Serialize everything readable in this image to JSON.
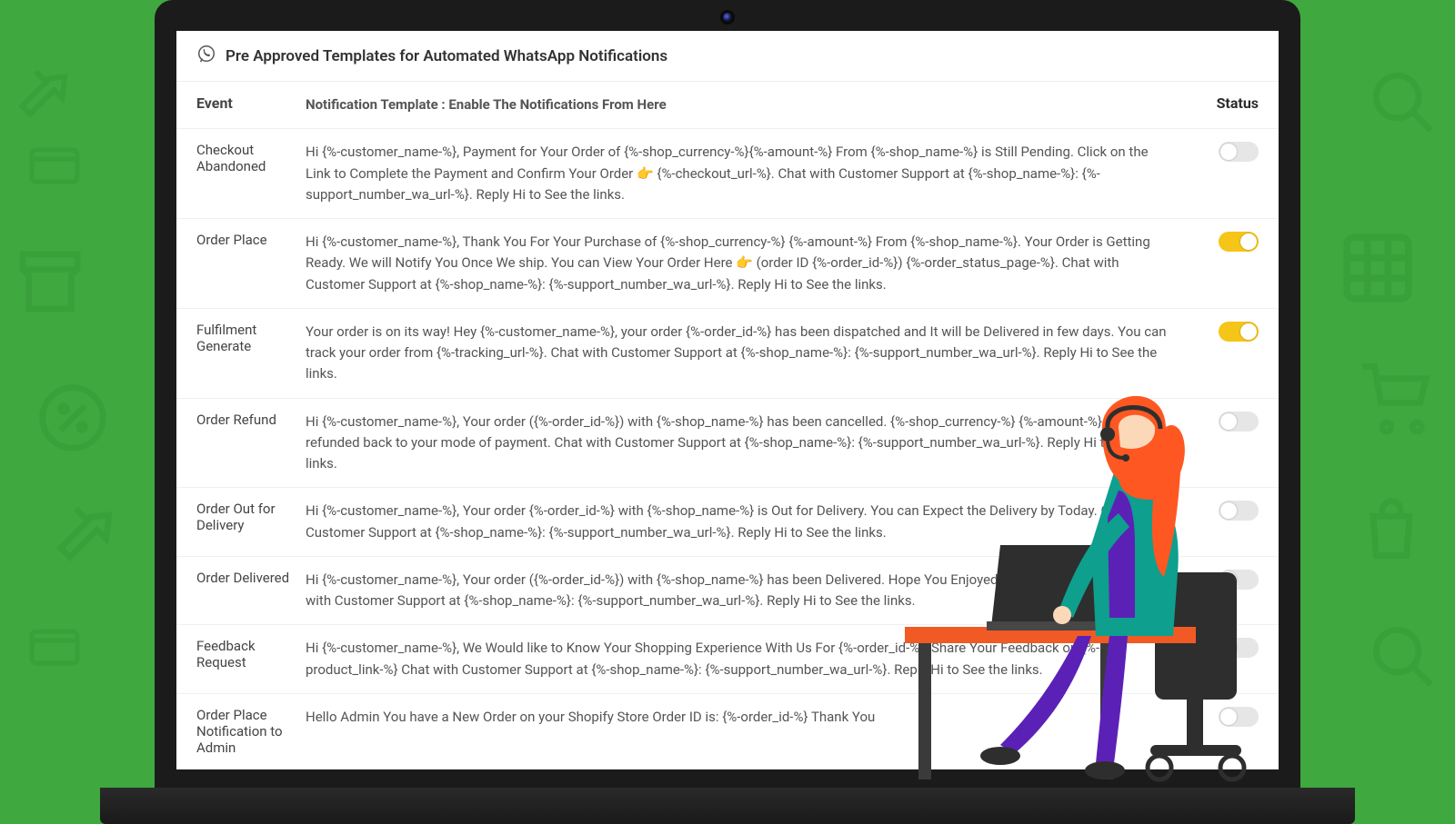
{
  "panel": {
    "title": "Pre Approved Templates for Automated WhatsApp Notifications"
  },
  "columns": {
    "event": "Event",
    "template": "Notification Template : Enable The Notifications From Here",
    "status": "Status"
  },
  "rows": [
    {
      "event": "Checkout Abandoned",
      "template": "Hi {%-customer_name-%}, Payment for Your Order of {%-shop_currency-%}{%-amount-%} From {%-shop_name-%} is Still Pending. Click on the Link to Complete the Payment and Confirm Your Order 👉 {%-checkout_url-%}. Chat with Customer Support at {%-shop_name-%}: {%-support_number_wa_url-%}. Reply Hi to See the links.",
      "on": false
    },
    {
      "event": "Order Place",
      "template": "Hi {%-customer_name-%}, Thank You For Your Purchase of {%-shop_currency-%} {%-amount-%} From {%-shop_name-%}. Your Order is Getting Ready. We will Notify You Once We ship. You can View Your Order Here 👉 (order ID {%-order_id-%}) {%-order_status_page-%}. Chat with Customer Support at {%-shop_name-%}: {%-support_number_wa_url-%}. Reply Hi to See the links.",
      "on": true
    },
    {
      "event": "Fulfilment Generate",
      "template": "Your order is on its way! Hey {%-customer_name-%}, your order {%-order_id-%} has been dispatched and It will be Delivered in few days. You can track your order from {%-tracking_url-%}. Chat with Customer Support at {%-shop_name-%}: {%-support_number_wa_url-%}. Reply Hi to See the links.",
      "on": true
    },
    {
      "event": "Order Refund",
      "template": "Hi {%-customer_name-%}, Your order ({%-order_id-%}) with {%-shop_name-%} has been cancelled. {%-shop_currency-%} {%-amount-%} will be refunded back to your mode of payment. Chat with Customer Support at {%-shop_name-%}: {%-support_number_wa_url-%}. Reply Hi to See the links.",
      "on": false
    },
    {
      "event": "Order Out for Delivery",
      "template": "Hi {%-customer_name-%}, Your order {%-order_id-%} with {%-shop_name-%} is Out for Delivery. You can Expect the Delivery by Today. Chat with Customer Support at {%-shop_name-%}: {%-support_number_wa_url-%}. Reply Hi to See the links.",
      "on": false
    },
    {
      "event": "Order Delivered",
      "template": "Hi {%-customer_name-%}, Your order ({%-order_id-%}) with {%-shop_name-%} has been Delivered. Hope You Enjoyed Shopping With Us. Chat with Customer Support at {%-shop_name-%}: {%-support_number_wa_url-%}. Reply Hi to See the links.",
      "on": false
    },
    {
      "event": "Feedback Request",
      "template": "Hi {%-customer_name-%}, We Would like to Know Your Shopping Experience With Us For {%-order_id-%}. Share Your Feedback on {%-product_link-%} Chat with Customer Support at {%-shop_name-%}: {%-support_number_wa_url-%}. Reply Hi to See the links.",
      "on": false
    },
    {
      "event": "Order Place Notification to Admin",
      "template": "Hello Admin You have a New Order on your Shopify Store Order ID is: {%-order_id-%} Thank You",
      "on": false
    }
  ]
}
